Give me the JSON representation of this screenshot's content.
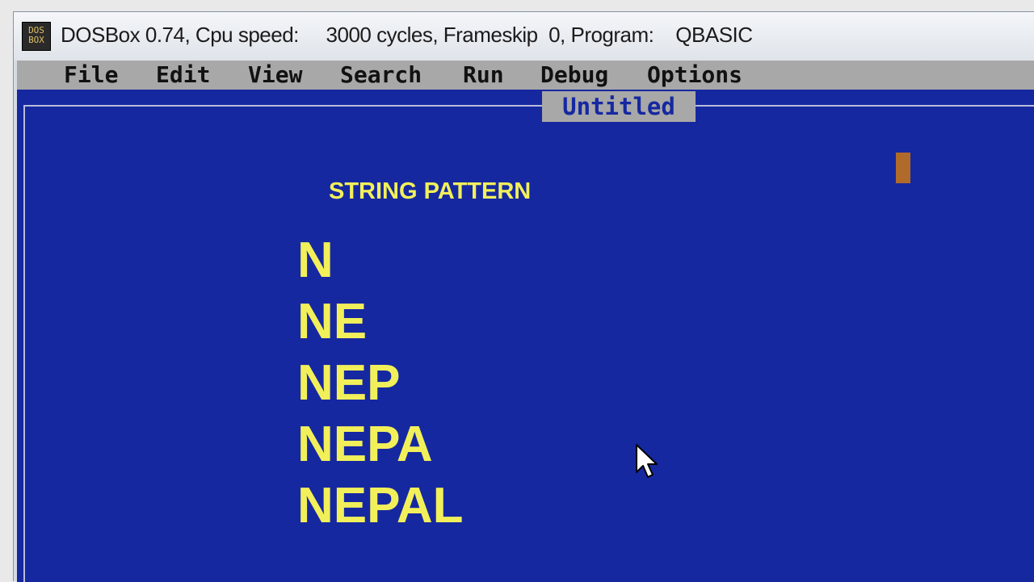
{
  "window": {
    "title": "DOSBox 0.74, Cpu speed:     3000 cycles, Frameskip  0, Program:    QBASIC",
    "icon_text": "DOS\nBOX",
    "icon": "dosbox-icon"
  },
  "menu": {
    "items": [
      "File",
      "Edit",
      "View",
      "Search",
      "Run",
      "Debug",
      "Options"
    ]
  },
  "editor": {
    "tab_title": "Untitled"
  },
  "content": {
    "heading": "STRING PATTERN",
    "lines": [
      "N",
      "NE",
      "NEP",
      "NEPA",
      "NEPAL"
    ]
  },
  "colors": {
    "dos_background": "#1628a0",
    "menu_bar": "#a8a8a8",
    "text_yellow": "#f2f05a"
  }
}
